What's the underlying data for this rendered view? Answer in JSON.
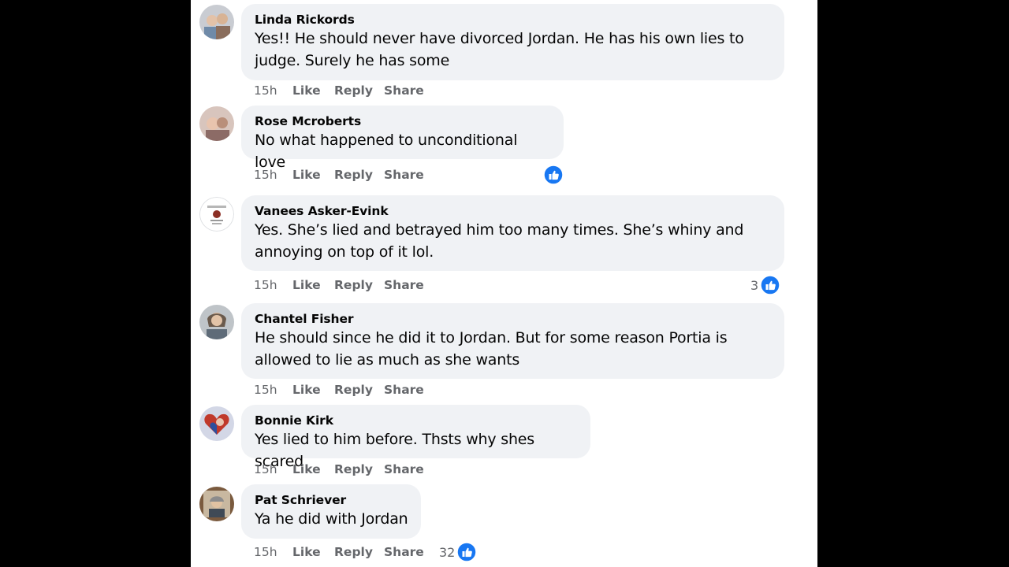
{
  "comments": [
    {
      "author": "Linda Rickords",
      "lines": [
        "Yes!! He should never have divorced Jordan. He has his own lies to",
        "judge. Surely he has some"
      ],
      "time": "15h",
      "like": "Like",
      "reply": "Reply",
      "share": "Share",
      "reactions": null
    },
    {
      "author": "Rose Mcroberts",
      "lines": [
        "No what happened to unconditional love"
      ],
      "time": "15h",
      "like": "Like",
      "reply": "Reply",
      "share": "Share",
      "reactions": {
        "icon": "thumbs-up-icon",
        "count": ""
      }
    },
    {
      "author": "Vanees Asker-Evink",
      "lines": [
        "Yes. She’s lied and betrayed him too many times. She’s whiny and",
        "annoying on top of it lol."
      ],
      "time": "15h",
      "like": "Like",
      "reply": "Reply",
      "share": "Share",
      "reactions": {
        "icon": "thumbs-up-icon",
        "count": "3"
      }
    },
    {
      "author": "Chantel Fisher",
      "lines": [
        "He should since he did it to Jordan. But for some reason Portia is",
        "allowed to lie as much as she wants"
      ],
      "time": "15h",
      "like": "Like",
      "reply": "Reply",
      "share": "Share",
      "reactions": null
    },
    {
      "author": "Bonnie Kirk",
      "lines": [
        "Yes lied to him before. Thsts why shes scared"
      ],
      "time": "15h",
      "like": "Like",
      "reply": "Reply",
      "share": "Share",
      "reactions": null
    },
    {
      "author": "Pat Schriever",
      "lines": [
        "Ya he did with Jordan"
      ],
      "time": "15h",
      "like": "Like",
      "reply": "Reply",
      "share": "Share",
      "reactions": {
        "icon": "thumbs-up-icon",
        "count": "32"
      }
    }
  ],
  "colors": {
    "background": "#000000",
    "panel": "#ffffff",
    "bubble": "#f0f2f5",
    "text": "#050505",
    "secondary_text": "#65676b",
    "like_blue": "#1877f2"
  }
}
